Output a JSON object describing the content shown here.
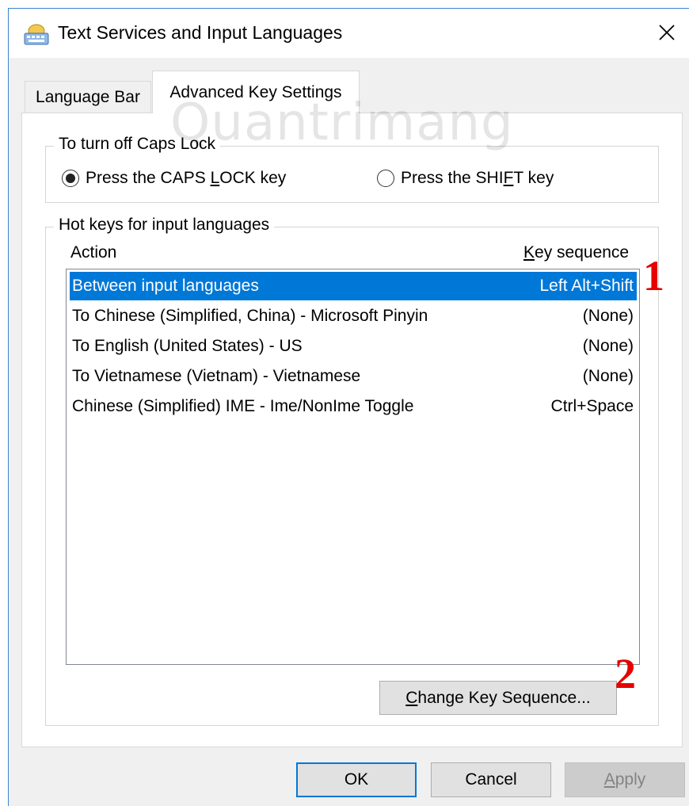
{
  "window": {
    "title": "Text Services and Input Languages",
    "app_icon": "keyboard-icon",
    "close_icon": "close-icon"
  },
  "tabs": [
    {
      "label": "Language Bar",
      "active": false
    },
    {
      "label": "Advanced Key Settings",
      "active": true
    }
  ],
  "caps_lock": {
    "legend": "To turn off Caps Lock",
    "options": [
      {
        "pre": "Press the CAPS ",
        "ul": "L",
        "post": "OCK key",
        "selected": true
      },
      {
        "pre": "Press the SHI",
        "ul": "F",
        "post": "T key",
        "selected": false
      }
    ]
  },
  "hotkeys": {
    "legend": "Hot keys for input languages",
    "col_action": "Action",
    "col_key_ul": "K",
    "col_key_rest": "ey sequence",
    "rows": [
      {
        "action": "Between input languages",
        "key": "Left Alt+Shift",
        "selected": true
      },
      {
        "action": "To Chinese (Simplified, China) - Microsoft Pinyin",
        "key": "(None)",
        "selected": false
      },
      {
        "action": "To English (United States) - US",
        "key": "(None)",
        "selected": false
      },
      {
        "action": "To Vietnamese (Vietnam) - Vietnamese",
        "key": "(None)",
        "selected": false
      },
      {
        "action": "Chinese (Simplified) IME - Ime/NonIme Toggle",
        "key": "Ctrl+Space",
        "selected": false
      }
    ],
    "change_ul": "C",
    "change_rest": "hange Key Sequence..."
  },
  "buttons": {
    "ok": "OK",
    "cancel": "Cancel",
    "apply_ul": "A",
    "apply_rest": "pply"
  },
  "annotations": {
    "step1": "1",
    "step2": "2"
  },
  "watermark": "Quantrimang",
  "colors": {
    "selection": "#0078d7",
    "annotation": "#e60000",
    "window_border": "#3b83d1"
  }
}
